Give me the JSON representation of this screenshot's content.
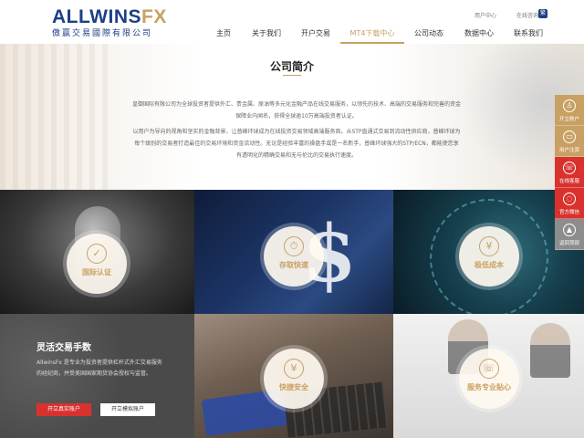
{
  "header": {
    "logo_text_main": "ALLWINS",
    "logo_text_fx": "FX",
    "logo_sub": "傲赢交易國際有限公司",
    "user_center": "用户中心",
    "online_consult": "在线咨询",
    "lang_label": "繁"
  },
  "nav": {
    "items": [
      {
        "label": "主页"
      },
      {
        "label": "关于我们"
      },
      {
        "label": "开户交易"
      },
      {
        "label": "MT4下载中心"
      },
      {
        "label": "公司动态"
      },
      {
        "label": "数据中心"
      },
      {
        "label": "联系我们"
      }
    ],
    "active_index": 3
  },
  "intro": {
    "title": "公司简介",
    "p1": "皇御国际有限公司为全球投资者提供外汇、贵金属、原油等多元化金融产品在线交易服务，以领先的技术、高端的交易服务和完善的资金保障业内闻名，获得全球逾10万高端投资者认证。",
    "p2": "以用户为导向的视角和坚实的金融背景，让普峰环球成为在线投资交易领域高端服务商。从STP直通式交易到流动性供应商，普峰环球为每个级别的交易者打造最佳的交易环境和资金流动性。无论是经验丰富的操盘手或是一名新手，普峰环球强大的STP/ECN，都能使您享有透明化的精确交易和无与伦比的交易执行速度。"
  },
  "sidebar": {
    "items": [
      {
        "label": "开立账户",
        "icon": "user-icon",
        "color": "#c9a063"
      },
      {
        "label": "用户注资",
        "icon": "wallet-icon",
        "color": "#c9a063"
      },
      {
        "label": "在线客服",
        "icon": "headset-icon",
        "color": "#d9322e"
      },
      {
        "label": "官方微信",
        "icon": "wechat-icon",
        "color": "#d9322e"
      },
      {
        "label": "返回顶部",
        "icon": "arrow-up-icon",
        "color": "#8d8d8d"
      }
    ]
  },
  "tiles": {
    "t1_label": "国际认证",
    "t2_label": "存取快速",
    "t3_label": "极低成本",
    "t4_title": "灵活交易手数",
    "t4_text": "AllwinsFx 是专业为投资者提供杠杆式外汇交易服务的经纪商，并受美国国家期货协会授权与监管。",
    "t4_btn_real": "开立真实账户",
    "t4_btn_demo": "开立模拟账户",
    "t5_label": "快捷安全",
    "t6_label": "服务专业贴心"
  },
  "colors": {
    "brand_blue": "#1e3f86",
    "gold": "#c9a063",
    "red": "#d9322e"
  }
}
